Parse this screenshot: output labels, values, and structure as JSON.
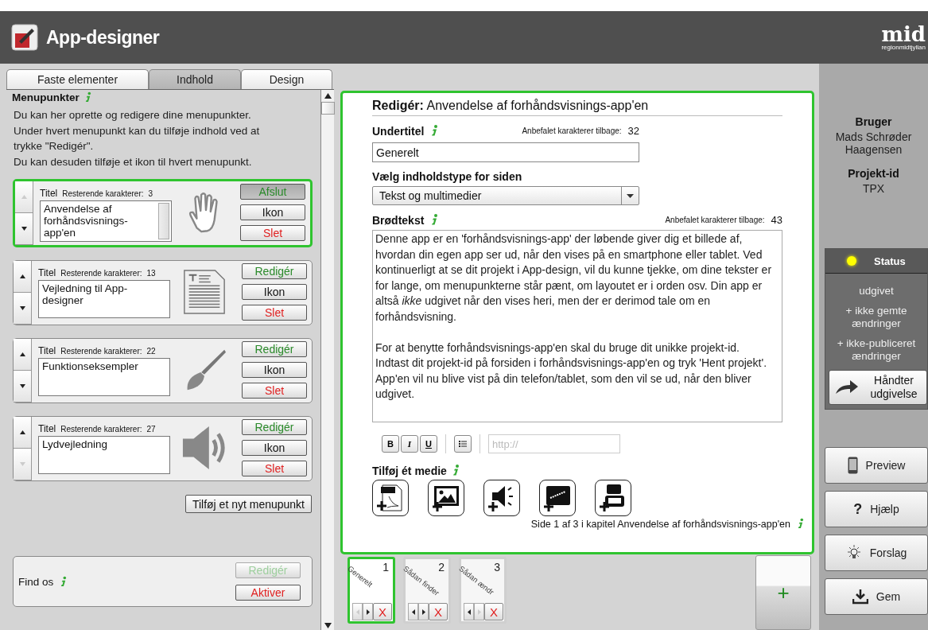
{
  "header": {
    "title": "App-designer",
    "logo_text": "mid",
    "logo_subtext": "regionmidtjyllan"
  },
  "tabs": [
    {
      "label": "Faste elementer",
      "selected": false
    },
    {
      "label": "Indhold",
      "selected": true
    },
    {
      "label": "Design",
      "selected": false
    }
  ],
  "menu": {
    "heading": "Menupunkter",
    "intro": [
      "Du kan her oprette og redigere dine menupunkter.",
      "Under hvert menupunkt kan du tilføje indhold ved at",
      "trykke \"Redigér\".",
      "Du kan desuden tilføje et ikon til hvert menupunkt."
    ],
    "items": [
      {
        "title_label": "Titel",
        "remaining_label": "Resterende karakterer:",
        "remaining": "3",
        "value": "Anvendelse af forhåndsvisnings-app'en",
        "kind": "hand",
        "active": true,
        "up_disabled": true,
        "down_disabled": false,
        "edit_label": "Afslut",
        "icon_label": "Ikon",
        "delete_label": "Slet"
      },
      {
        "title_label": "Titel",
        "remaining_label": "Resterende karakterer:",
        "remaining": "13",
        "value": "Vejledning til App-designer",
        "kind": "document",
        "active": false,
        "up_disabled": false,
        "down_disabled": false,
        "edit_label": "Redigér",
        "icon_label": "Ikon",
        "delete_label": "Slet"
      },
      {
        "title_label": "Titel",
        "remaining_label": "Resterende karakterer:",
        "remaining": "22",
        "value": "Funktionseksempler",
        "kind": "brush",
        "active": false,
        "up_disabled": false,
        "down_disabled": false,
        "edit_label": "Redigér",
        "icon_label": "Ikon",
        "delete_label": "Slet"
      },
      {
        "title_label": "Titel",
        "remaining_label": "Resterende karakterer:",
        "remaining": "27",
        "value": "Lydvejledning",
        "kind": "speaker",
        "active": false,
        "up_disabled": false,
        "down_disabled": true,
        "edit_label": "Redigér",
        "icon_label": "Ikon",
        "delete_label": "Slet"
      }
    ],
    "add_label": "Tilføj et nyt menupunkt",
    "find": {
      "label": "Find os",
      "edit_label": "Redigér",
      "edit_disabled": true,
      "activate_label": "Aktiver"
    }
  },
  "editor": {
    "heading_label": "Redigér:",
    "heading": "Anvendelse af forhåndsvisnings-app'en",
    "subtitle": {
      "label": "Undertitel",
      "counter_label": "Anbefalet karakterer tilbage:",
      "counter": "32",
      "value": "Generelt"
    },
    "content_type": {
      "label": "Vælg indholdstype for siden",
      "value": "Tekst og multimedier"
    },
    "body": {
      "label": "Brødtekst",
      "counter_label": "Anbefalet karakterer tilbage:",
      "counter": "43",
      "paragraphs": [
        "Denne app er en 'forhåndsvisnings-app' der løbende giver dig et billede af, hvordan din egen app ser ud, når den vises på en smartphone eller tablet. Ved kontinuerligt at se dit projekt i App-design, vil du kunne tjekke, om dine tekster er for lange, om menupunkterne står pænt, om layoutet er i orden osv. Din app er altså *ikke* udgivet når den vises heri, men der er derimod tale om en forhåndsvisning.",
        "For at benytte forhåndsvisnings-app'en skal du bruge dit unikke projekt-id. Indtast dit projekt-id på forsiden i forhåndsvisnings-app'en og tryk 'Hent projekt'. App'en vil nu blive vist på din telefon/tablet, som den vil se ud, når den bliver udgivet."
      ]
    },
    "format_buttons": [
      {
        "kind": "bold",
        "label": "B"
      },
      {
        "kind": "italic",
        "label": "I"
      },
      {
        "kind": "underline",
        "label": "U"
      }
    ],
    "url_placeholder": "http://",
    "media": {
      "label": "Tilføj ét medie",
      "items": [
        {
          "kind": "pdf"
        },
        {
          "kind": "image"
        },
        {
          "kind": "audio"
        },
        {
          "kind": "web"
        },
        {
          "kind": "video"
        }
      ]
    },
    "footer": "Side 1 af 3 i kapitel Anvendelse af forhåndsvisnings-app'en"
  },
  "pages": [
    {
      "number": "1",
      "title": "Generelt",
      "selected": true,
      "left_disabled": true,
      "right_disabled": false,
      "delete_label": "X"
    },
    {
      "number": "2",
      "title": "Sådan finder",
      "selected": false,
      "left_disabled": false,
      "right_disabled": false,
      "delete_label": "X"
    },
    {
      "number": "3",
      "title": "Sådan ændr",
      "selected": false,
      "left_disabled": false,
      "right_disabled": true,
      "delete_label": "X"
    }
  ],
  "add_page_label": "+",
  "sidebar": {
    "user_label": "Bruger",
    "user_name": "Mads Schrøder Haagensen",
    "project_label": "Projekt-id",
    "project_id": "TPX",
    "status": {
      "title": "Status",
      "color": "#ffff00",
      "lines": [
        "udgivet",
        "+ ikke gemte ændringer",
        "+ ikke-publiceret ændringer"
      ],
      "publish_label": "Håndter udgivelse"
    },
    "actions": [
      {
        "kind": "phone",
        "label": "Preview"
      },
      {
        "kind": "help",
        "glyph": "?",
        "label": "Hjælp"
      },
      {
        "kind": "bulb",
        "label": "Forslag"
      },
      {
        "kind": "download",
        "label": "Gem"
      }
    ]
  }
}
